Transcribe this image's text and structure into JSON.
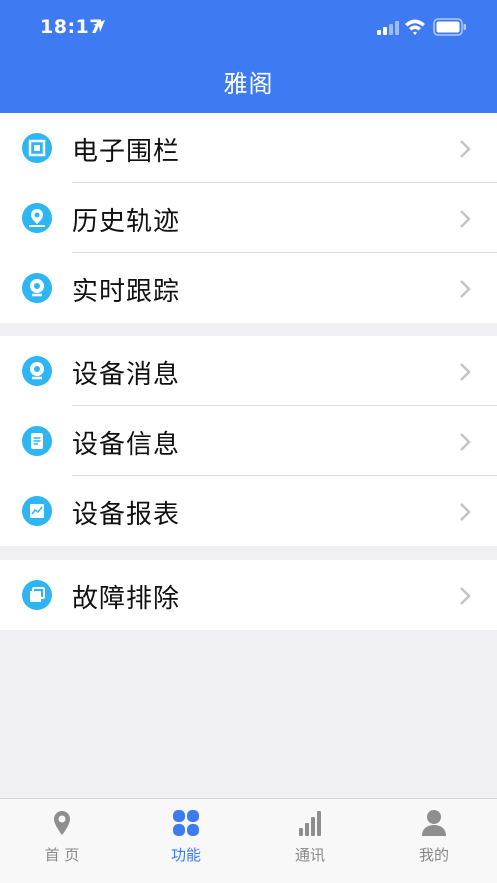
{
  "status_bar": {
    "time": "18:17"
  },
  "header": {
    "title": "雅阁"
  },
  "groups": [
    {
      "items": [
        {
          "label": "电子围栏",
          "icon": "fence-icon"
        },
        {
          "label": "历史轨迹",
          "icon": "location-history-icon"
        },
        {
          "label": "实时跟踪",
          "icon": "realtime-tracking-icon"
        }
      ]
    },
    {
      "items": [
        {
          "label": "设备消息",
          "icon": "device-message-icon"
        },
        {
          "label": "设备信息",
          "icon": "device-info-icon"
        },
        {
          "label": "设备报表",
          "icon": "device-report-icon"
        }
      ]
    },
    {
      "items": [
        {
          "label": "故障排除",
          "icon": "troubleshoot-icon"
        }
      ]
    }
  ],
  "tabbar": {
    "active": 1,
    "tabs": [
      {
        "label": "首 页",
        "icon": "map-pin-icon"
      },
      {
        "label": "功能",
        "icon": "grid-icon"
      },
      {
        "label": "通讯",
        "icon": "signal-bars-icon"
      },
      {
        "label": "我的",
        "icon": "user-icon"
      }
    ]
  },
  "colors": {
    "header": "#3e7bf3",
    "icon_bg": "#2eb6f2",
    "tab_active": "#3e7bf3",
    "tab_inactive": "#888888",
    "background": "#efeff4"
  }
}
